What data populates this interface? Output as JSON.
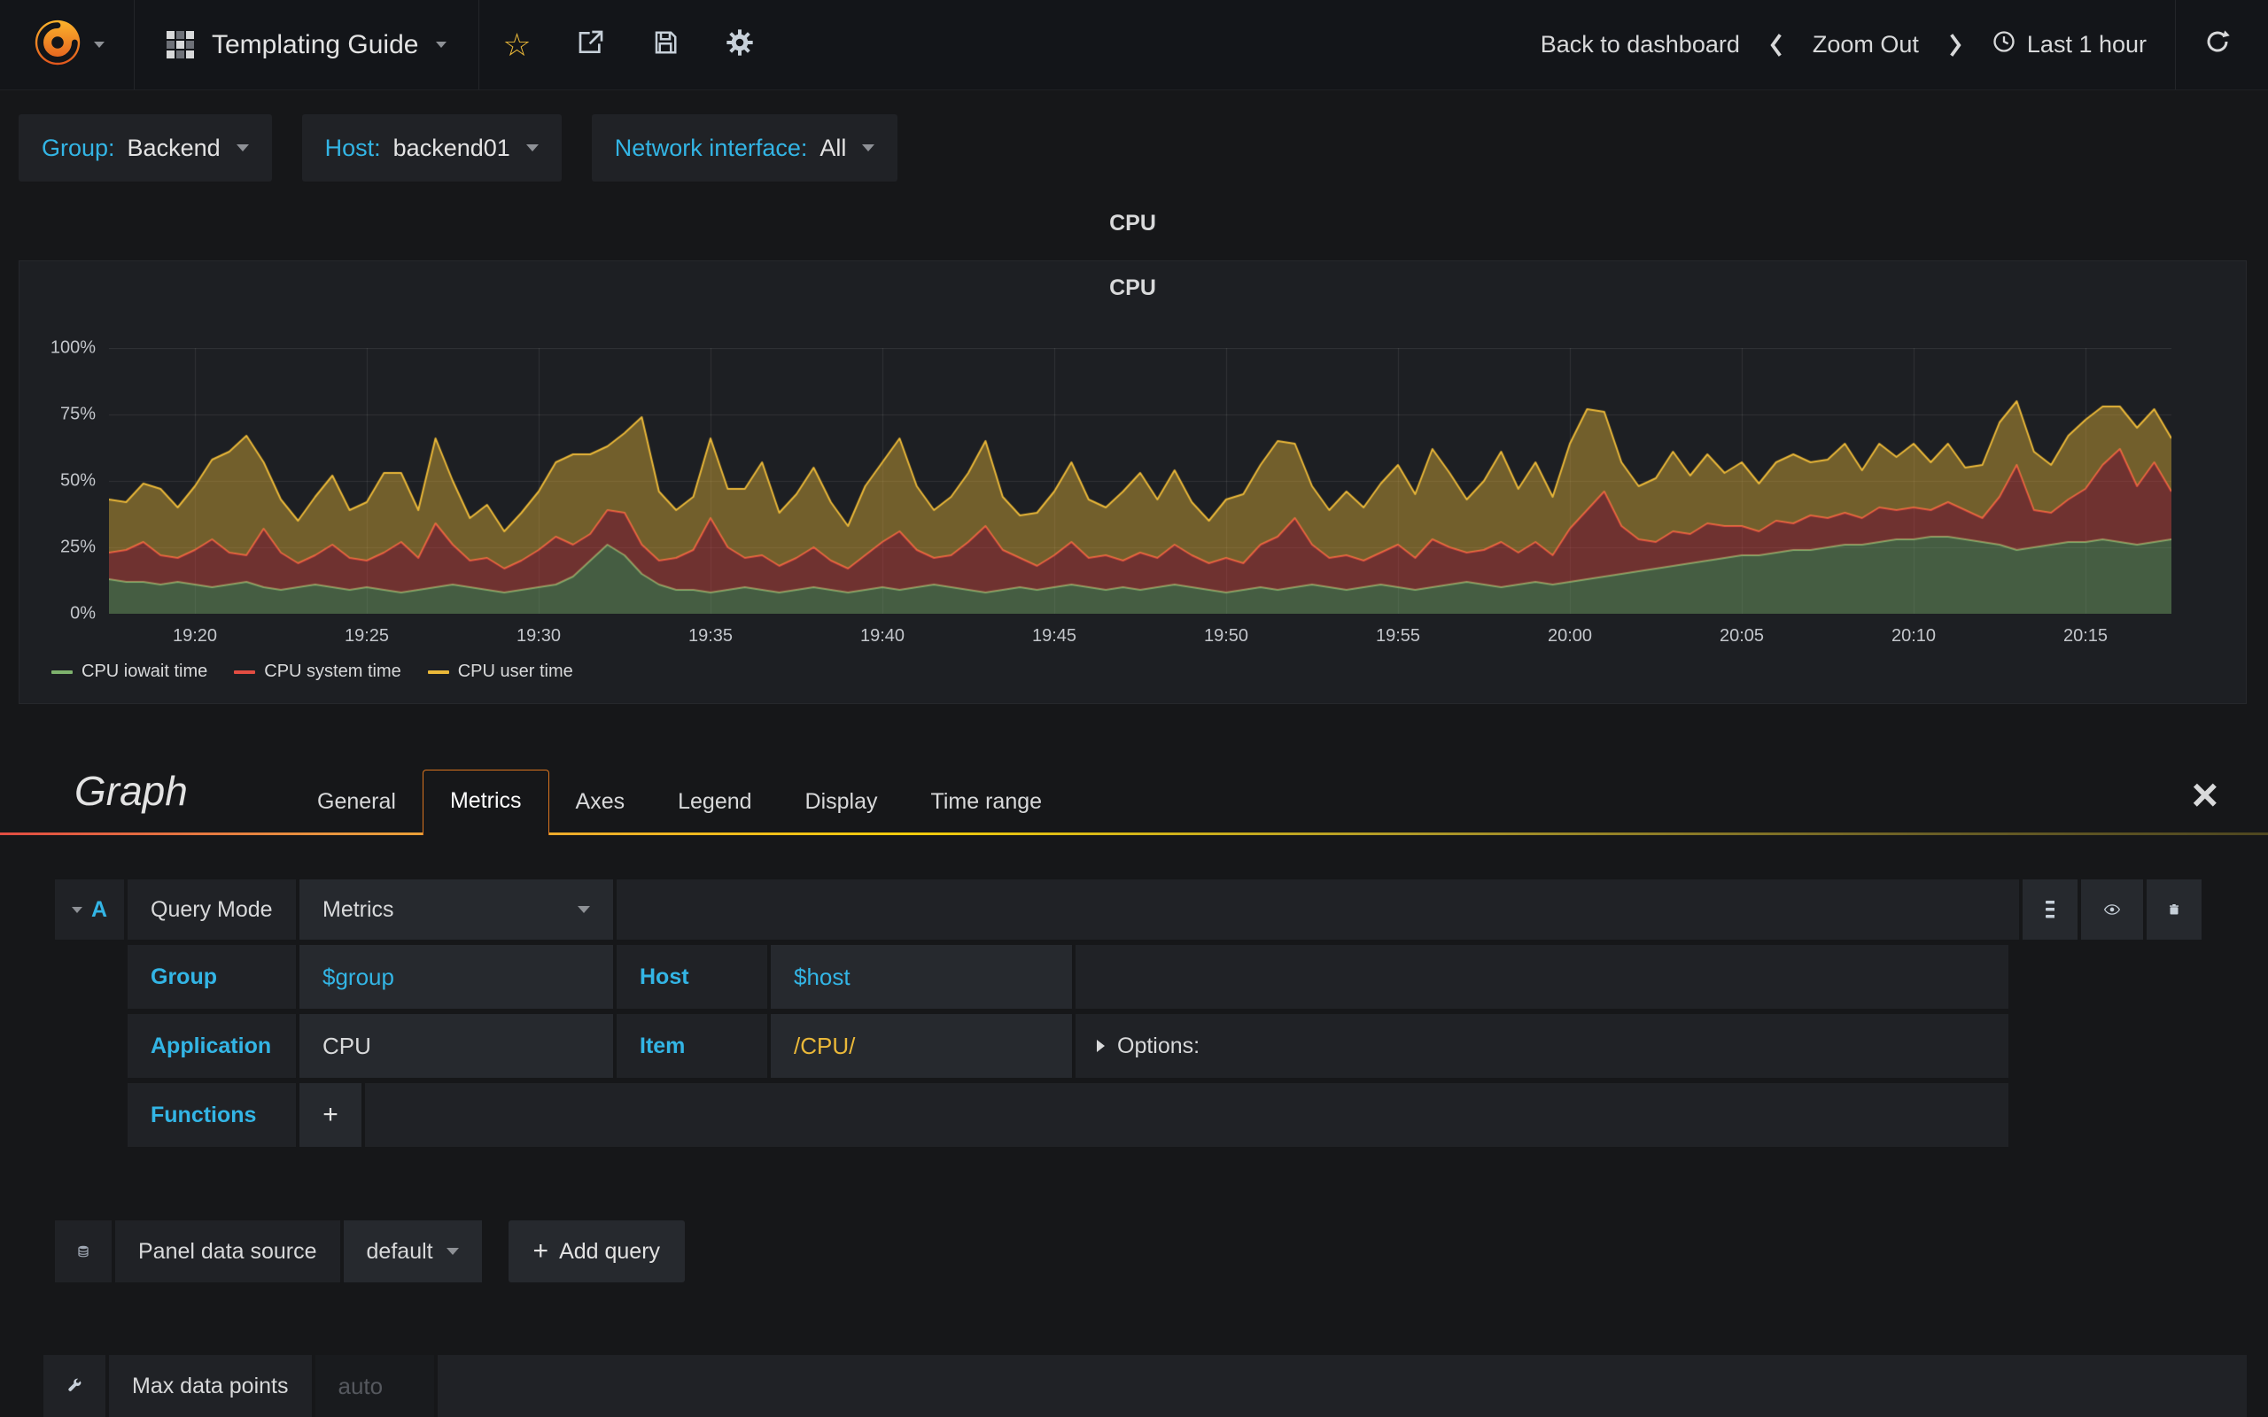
{
  "navbar": {
    "title": "Templating Guide",
    "back_to_dashboard": "Back to dashboard",
    "zoom_out": "Zoom Out",
    "time_range": "Last 1 hour"
  },
  "icons": {
    "star_glyph": "☆",
    "close_glyph": "×"
  },
  "template_vars": [
    {
      "label": "Group:",
      "value": "Backend"
    },
    {
      "label": "Host:",
      "value": "backend01"
    },
    {
      "label": "Network interface:",
      "value": "All"
    }
  ],
  "panel": {
    "header_title": "CPU",
    "chart_title": "CPU"
  },
  "chart_data": {
    "type": "area",
    "stacked": true,
    "title": "CPU",
    "xlabel": "",
    "ylabel": "",
    "ylim": [
      0,
      100
    ],
    "y_ticks": [
      "0%",
      "25%",
      "50%",
      "75%",
      "100%"
    ],
    "y_tick_values": [
      0,
      25,
      50,
      75,
      100
    ],
    "x_ticks": [
      "19:20",
      "19:25",
      "19:30",
      "19:35",
      "19:40",
      "19:45",
      "19:50",
      "19:55",
      "20:00",
      "20:05",
      "20:10",
      "20:15"
    ],
    "x_tick_minutes": [
      2.5,
      7.5,
      12.5,
      17.5,
      22.5,
      27.5,
      32.5,
      37.5,
      42.5,
      47.5,
      52.5,
      57.5
    ],
    "x_total_minutes": 60,
    "grid": true,
    "legend_position": "bottom-left",
    "fill_alpha": 0.42,
    "series": [
      {
        "name": "CPU iowait time",
        "color": "#7EB26D",
        "values": [
          13,
          12,
          12,
          11,
          12,
          11,
          10,
          11,
          12,
          10,
          9,
          10,
          11,
          10,
          9,
          10,
          9,
          8,
          9,
          10,
          11,
          10,
          9,
          8,
          9,
          10,
          11,
          14,
          20,
          26,
          22,
          15,
          11,
          9,
          9,
          8,
          9,
          10,
          9,
          8,
          9,
          10,
          9,
          8,
          9,
          10,
          9,
          10,
          11,
          10,
          9,
          8,
          9,
          10,
          9,
          10,
          11,
          10,
          9,
          10,
          9,
          10,
          11,
          10,
          9,
          8,
          9,
          10,
          9,
          10,
          11,
          10,
          9,
          10,
          11,
          10,
          9,
          10,
          11,
          12,
          11,
          10,
          11,
          12,
          11,
          12,
          13,
          14,
          15,
          16,
          17,
          18,
          19,
          20,
          21,
          22,
          22,
          23,
          24,
          24,
          25,
          26,
          26,
          27,
          28,
          28,
          29,
          29,
          28,
          27,
          26,
          24,
          25,
          26,
          27,
          27,
          28,
          27,
          26,
          27,
          28
        ]
      },
      {
        "name": "CPU system time",
        "color": "#E24D42",
        "values": [
          10,
          12,
          15,
          11,
          9,
          13,
          18,
          12,
          10,
          22,
          14,
          9,
          11,
          16,
          12,
          10,
          14,
          19,
          12,
          24,
          15,
          10,
          12,
          9,
          11,
          14,
          18,
          12,
          10,
          13,
          16,
          11,
          9,
          12,
          15,
          28,
          16,
          11,
          13,
          10,
          12,
          15,
          11,
          9,
          13,
          17,
          22,
          14,
          10,
          12,
          18,
          25,
          15,
          11,
          9,
          12,
          16,
          11,
          13,
          10,
          14,
          11,
          15,
          12,
          10,
          13,
          10,
          16,
          20,
          26,
          15,
          11,
          13,
          10,
          12,
          16,
          12,
          18,
          14,
          11,
          13,
          17,
          12,
          15,
          11,
          20,
          26,
          32,
          18,
          12,
          10,
          13,
          11,
          14,
          12,
          11,
          9,
          12,
          10,
          13,
          11,
          12,
          10,
          13,
          11,
          12,
          10,
          13,
          11,
          9,
          18,
          32,
          14,
          12,
          16,
          20,
          28,
          35,
          22,
          30,
          18
        ]
      },
      {
        "name": "CPU user time",
        "color": "#EAB839",
        "values": [
          20,
          18,
          22,
          25,
          19,
          24,
          30,
          38,
          45,
          25,
          20,
          16,
          22,
          26,
          18,
          22,
          30,
          26,
          18,
          32,
          24,
          16,
          20,
          14,
          18,
          22,
          28,
          34,
          30,
          24,
          30,
          48,
          26,
          18,
          20,
          30,
          22,
          26,
          35,
          20,
          24,
          30,
          22,
          16,
          26,
          30,
          35,
          24,
          18,
          22,
          26,
          32,
          20,
          16,
          20,
          24,
          30,
          22,
          18,
          26,
          30,
          22,
          28,
          20,
          16,
          22,
          26,
          30,
          36,
          28,
          22,
          18,
          24,
          20,
          26,
          30,
          24,
          34,
          28,
          20,
          26,
          34,
          24,
          30,
          22,
          32,
          38,
          30,
          24,
          20,
          24,
          30,
          22,
          26,
          20,
          24,
          18,
          22,
          26,
          20,
          22,
          26,
          18,
          24,
          20,
          24,
          18,
          22,
          16,
          20,
          28,
          24,
          22,
          18,
          24,
          26,
          22,
          16,
          22,
          20,
          20
        ]
      }
    ]
  },
  "editor": {
    "panel_type": "Graph",
    "tabs": [
      "General",
      "Metrics",
      "Axes",
      "Legend",
      "Display",
      "Time range"
    ],
    "active_tab": "Metrics",
    "query": {
      "letter": "A",
      "mode_label": "Query Mode",
      "mode_value": "Metrics",
      "group_label": "Group",
      "group_value": "$group",
      "host_label": "Host",
      "host_value": "$host",
      "application_label": "Application",
      "application_value": "CPU",
      "item_label": "Item",
      "item_value": "/CPU/",
      "options_label": "Options:",
      "functions_label": "Functions",
      "add_function_label": "+"
    },
    "datasource": {
      "label": "Panel data source",
      "value": "default",
      "plus": "+",
      "add_query_label": "Add query"
    },
    "footer": {
      "max_data_points_label": "Max data points",
      "max_data_points_placeholder": "auto"
    }
  }
}
